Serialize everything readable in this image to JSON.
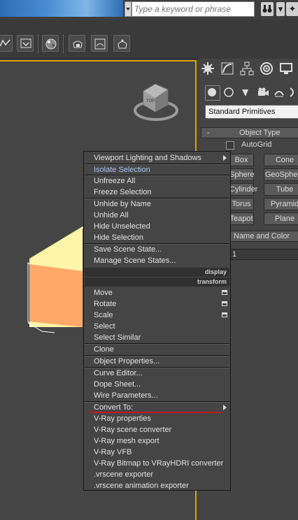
{
  "search": {
    "placeholder": "Type a keyword or phrase"
  },
  "command_panel": {
    "dropdown_value": "Standard Primitives",
    "rollout_object_type": "Object Type",
    "autogrid_label": "AutoGrid",
    "buttons": [
      "Box",
      "Cone",
      "Sphere",
      "GeoSphere",
      "Cylinder",
      "Tube",
      "Torus",
      "Pyramid",
      "Teapot",
      "Plane"
    ],
    "rollout_name_color": "Name and Color",
    "name_value": "1"
  },
  "context_menu": {
    "viewport_lighting": "Viewport Lighting and Shadows",
    "isolate_selection": "Isolate Selection",
    "unfreeze_all": "Unfreeze All",
    "freeze_selection": "Freeze Selection",
    "unhide_by_name": "Unhide by Name",
    "unhide_all": "Unhide All",
    "hide_unselected": "Hide Unselected",
    "hide_selection": "Hide Selection",
    "save_scene_state": "Save Scene State...",
    "manage_scene_states": "Manage Scene States...",
    "header_display": "display",
    "header_transform": "transform",
    "move": "Move",
    "rotate": "Rotate",
    "scale": "Scale",
    "select": "Select",
    "select_similar": "Select Similar",
    "clone": "Clone",
    "object_properties": "Object Properties...",
    "curve_editor": "Curve Editor...",
    "dope_sheet": "Dope Sheet...",
    "wire_parameters": "Wire Parameters...",
    "convert_to": "Convert To:",
    "vray_properties": "V-Ray properties",
    "vray_scene_converter": "V-Ray scene converter",
    "vray_mesh_export": "V-Ray mesh export",
    "vray_vfb": "V-Ray VFB",
    "vray_bitmap_converter": "V-Ray Bitmap to VRayHDRI converter",
    "vrscene_exporter": ".vrscene exporter",
    "vrscene_animation_exporter": ".vrscene animation exporter"
  },
  "colors": {
    "viewport_border": "#d8a300",
    "cube_top": "#fff5a8",
    "cube_side": "#ffa868",
    "annotation_underline": "#c0191b",
    "isolate_text": "#a8c4f0"
  }
}
